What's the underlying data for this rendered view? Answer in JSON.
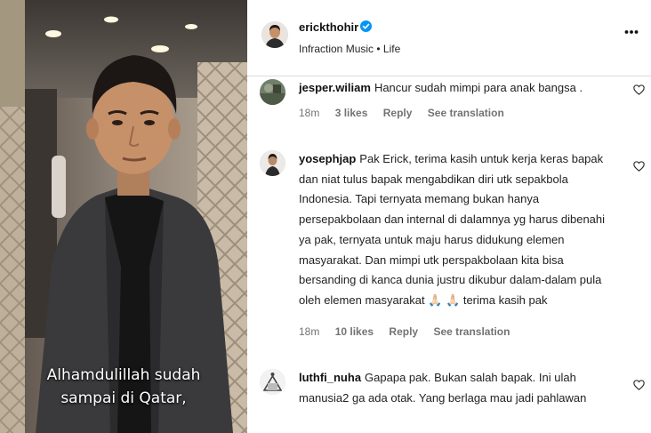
{
  "video": {
    "caption_line1": "Alhamdulillah sudah",
    "caption_line2": "sampai di Qatar,"
  },
  "post": {
    "username": "erickthohir",
    "verified": true,
    "subtitle": "Infraction Music • Life",
    "more_icon": "more-horizontal-icon"
  },
  "comments": [
    {
      "username": "jesper.wiliam",
      "text": "Hancur sudah mimpi para anak bangsa .",
      "time": "18m",
      "likes": "3 likes",
      "reply": "Reply",
      "translation": "See translation",
      "icon": "heart-icon"
    },
    {
      "username": "yosephjap",
      "text": "Pak Erick, terima kasih untuk kerja keras bapak dan niat tulus bapak mengabdikan diri utk sepakbola Indonesia. Tapi ternyata memang bukan hanya persepakbolaan dan internal di dalamnya yg harus dibenahi ya pak, ternyata untuk maju harus didukung elemen masyarakat. Dan mimpi utk perspakbolaan kita bisa bersanding di kanca dunia justru dikubur dalam-dalam pula oleh elemen masyarakat 🙏🏻 🙏🏻 terima kasih pak",
      "time": "18m",
      "likes": "10 likes",
      "reply": "Reply",
      "translation": "See translation",
      "icon": "heart-icon"
    },
    {
      "username": "luthfi_nuha",
      "text": "Gapapa pak. Bukan salah bapak. Ini ulah manusia2 ga ada otak. Yang berlaga mau jadi pahlawan",
      "icon": "heart-icon"
    }
  ],
  "colors": {
    "verified": "#0095f6",
    "meta_text": "#737373",
    "divider": "#dbdbdb"
  }
}
